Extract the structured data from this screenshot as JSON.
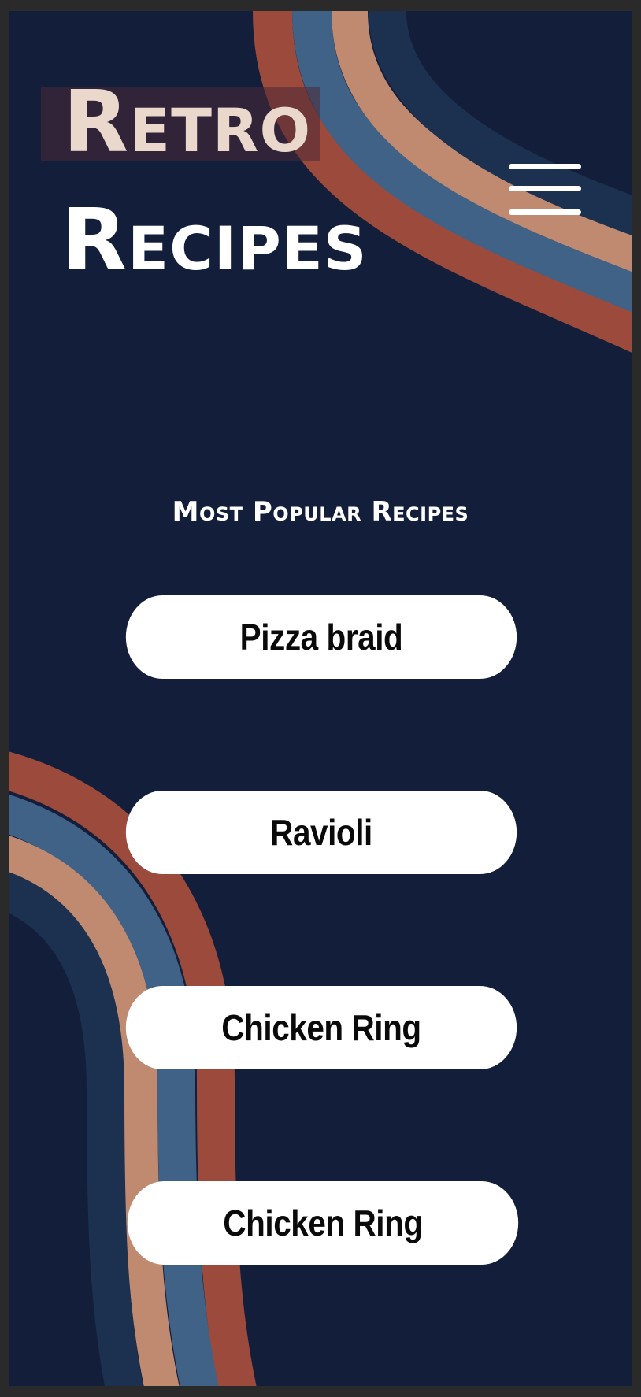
{
  "app": {
    "title_line1": "Retro",
    "title_line2": "Recipes"
  },
  "menu": {
    "icon": "hamburger-menu-icon"
  },
  "colors": {
    "background": "#131e3b",
    "stripe_red": "#9b4a3b",
    "stripe_blue": "#3f6286",
    "stripe_peach": "#c08a70",
    "stripe_navy": "#1c3150",
    "button_bg": "#ffffff",
    "button_text": "#0a0a0a"
  },
  "popular": {
    "heading": "Most Popular Recipes",
    "items": [
      {
        "label": "Pizza braid"
      },
      {
        "label": "Ravioli"
      },
      {
        "label": "Chicken Ring"
      },
      {
        "label": "Chicken Ring"
      }
    ]
  }
}
